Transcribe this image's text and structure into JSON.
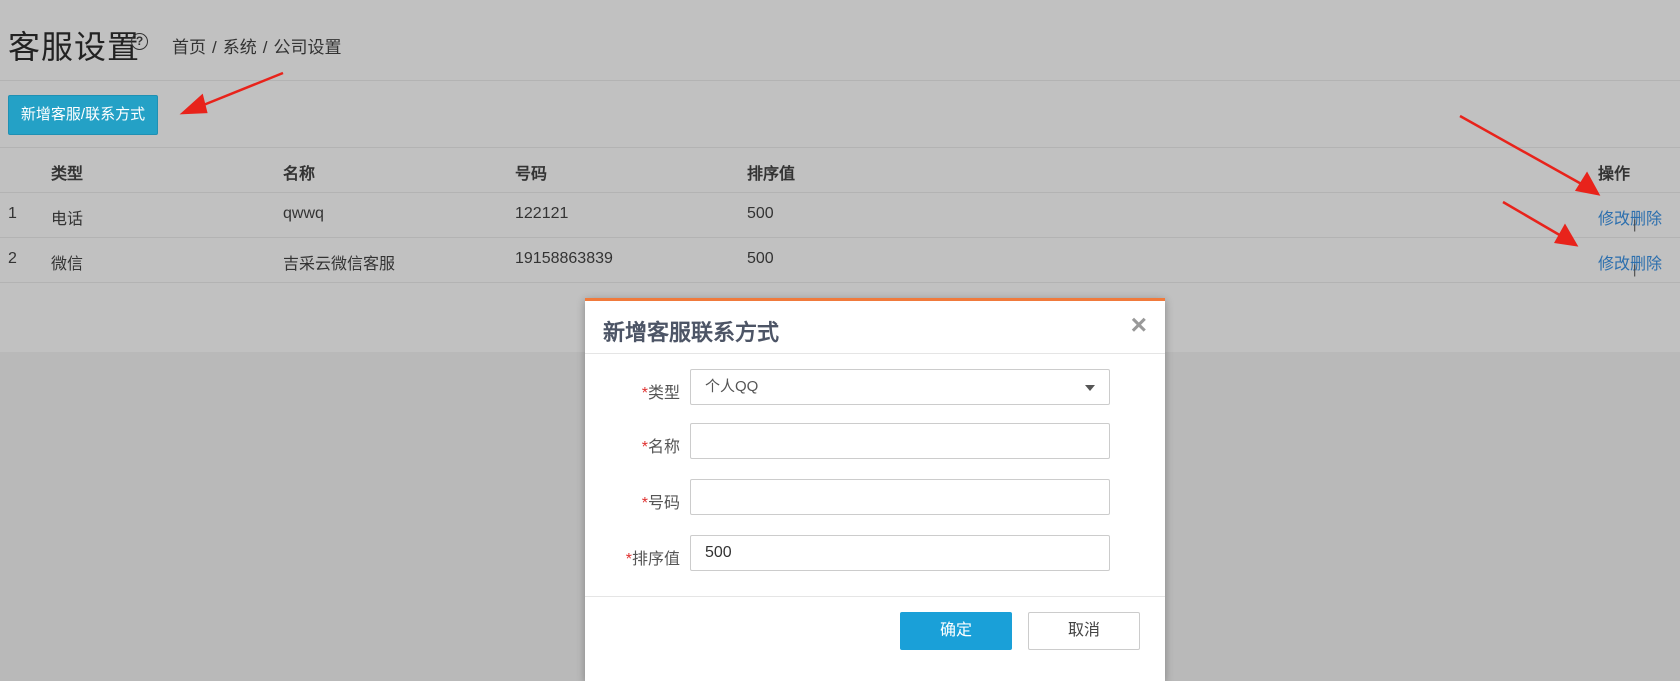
{
  "header": {
    "title": "客服设置",
    "help_icon": "question-circle-icon",
    "breadcrumb": [
      "首页",
      "系统",
      "公司设置"
    ],
    "breadcrumb_sep": "/"
  },
  "toolbar": {
    "add_label": "新增客服/联系方式"
  },
  "table": {
    "columns": [
      "类型",
      "名称",
      "号码",
      "排序值",
      "操作"
    ],
    "rows": [
      {
        "index": "1",
        "type": "电话",
        "name": "qwwq",
        "number": "122121",
        "sort": "500"
      },
      {
        "index": "2",
        "type": "微信",
        "name": "吉采云微信客服",
        "number": "19158863839",
        "sort": "500"
      }
    ],
    "edit_label": "修改",
    "delete_label": "删除",
    "op_separator": "|"
  },
  "modal": {
    "title": "新增客服联系方式",
    "close_icon": "close-icon",
    "required_mark": "*",
    "fields": {
      "type_label": "类型",
      "type_value": "个人QQ",
      "name_label": "名称",
      "name_value": "",
      "number_label": "号码",
      "number_value": "",
      "sort_label": "排序值",
      "sort_value": "500"
    },
    "ok_label": "确定",
    "cancel_label": "取消"
  },
  "colors": {
    "primary": "#24a1c6",
    "link": "#2c6fae",
    "modal_accent": "#f07a3c",
    "required": "#e0302f",
    "annotation_arrow": "#e8231b"
  }
}
